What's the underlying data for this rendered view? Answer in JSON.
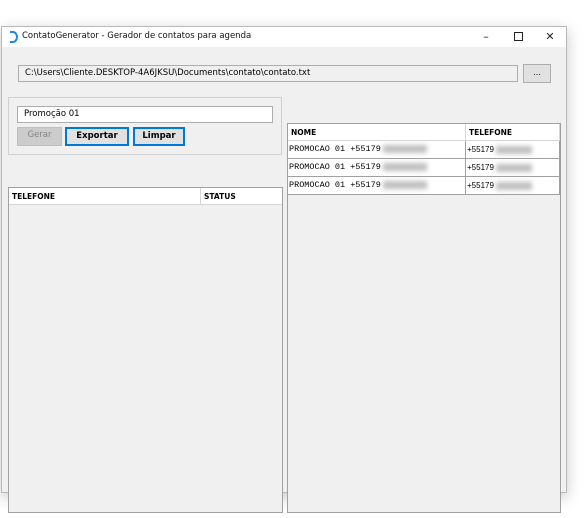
{
  "window": {
    "title": "ContatoGenerator - Gerador de contatos para agenda",
    "minimize_glyph": "–",
    "close_glyph": "✕",
    "app_icon": "contatogenerator-app-icon"
  },
  "file": {
    "path": "C:\\Users\\Cliente.DESKTOP-4A6JKSU\\Documents\\contato\\contato.txt",
    "browse_label": "..."
  },
  "form": {
    "name_value": "Promoção 01",
    "gerar_label": "Gerar",
    "exportar_label": "Exportar",
    "limpar_label": "Limpar"
  },
  "status_grid": {
    "columns": [
      "TELEFONE",
      "STATUS"
    ]
  },
  "contacts_grid": {
    "columns": [
      "NOME",
      "TELEFONE"
    ],
    "rows": [
      {
        "nome": "PROMOCAO 01 +55179",
        "telefone": "+55179"
      },
      {
        "nome": "PROMOCAO 01 +55179",
        "telefone": "+55179"
      },
      {
        "nome": "PROMOCAO 01 +55179",
        "telefone": "+55179"
      }
    ]
  },
  "colors": {
    "accent": "#0078d7",
    "window_bg": "#f0f0f0",
    "disabled_button": "#cccccc"
  }
}
